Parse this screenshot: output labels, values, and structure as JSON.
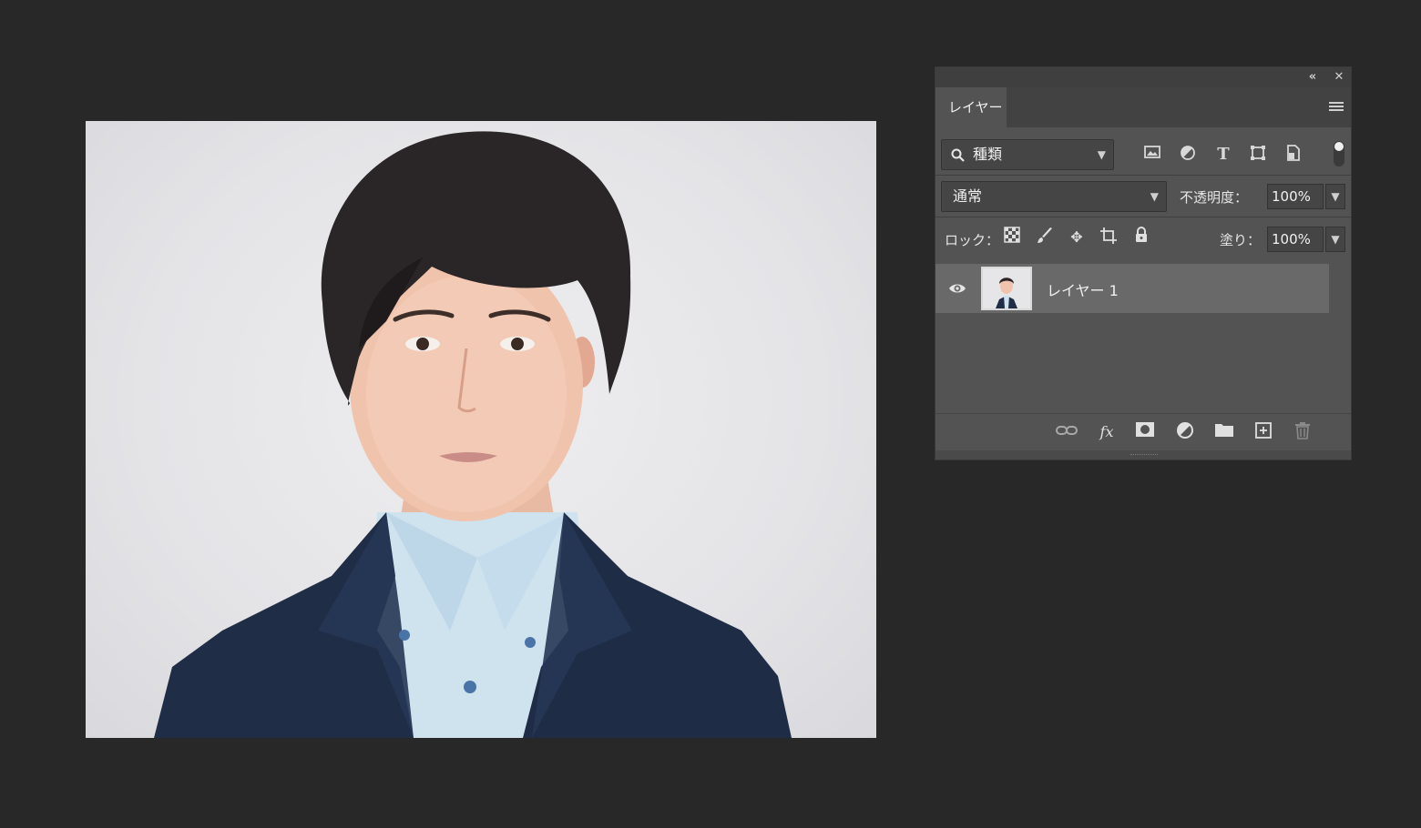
{
  "panel": {
    "tab_label": "レイヤー",
    "collapse_icon": "double-chevron-left-icon",
    "close_icon": "close-icon",
    "menu_icon": "hamburger-menu-icon"
  },
  "filter": {
    "label": "種類",
    "icons": [
      "image-filter-icon",
      "adjustment-filter-icon",
      "type-filter-icon",
      "shape-filter-icon",
      "smart-object-filter-icon"
    ]
  },
  "blend": {
    "mode": "通常",
    "opacity_label": "不透明度：",
    "opacity_value": "100%"
  },
  "lock": {
    "label": "ロック：",
    "icons": [
      "lock-transparent-pixels-icon",
      "lock-image-pixels-icon",
      "lock-position-icon",
      "lock-artboard-icon",
      "lock-all-icon"
    ],
    "fill_label": "塗り：",
    "fill_value": "100%"
  },
  "layers": [
    {
      "name": "レイヤー 1",
      "visible": true,
      "selected": true
    }
  ],
  "footer_icons": [
    "link-layers-icon",
    "fx-icon",
    "add-mask-icon",
    "new-adjustment-layer-icon",
    "new-group-icon",
    "new-layer-icon",
    "delete-layer-icon"
  ]
}
